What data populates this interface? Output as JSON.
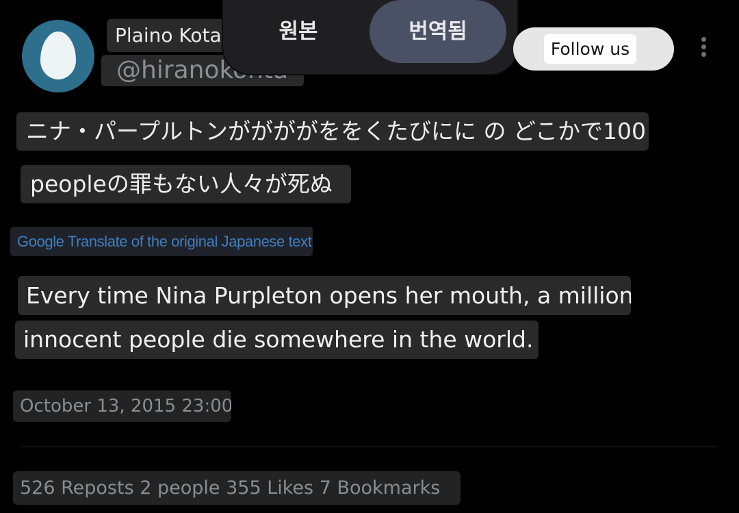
{
  "author": {
    "display_name": "Plaino Kota",
    "handle": "@hiranokonta"
  },
  "translation_toggle": {
    "original_label": "원본",
    "translated_label": "번역됨",
    "selected": "translated"
  },
  "follow_button": {
    "label": "Follow us"
  },
  "japanese_text": {
    "line1": "ニナ・パープルトンががががををくたびにに の どこかで100",
    "line2": "peopleの罪もない人々が死ぬ"
  },
  "translation_note": "Google Translate of the original Japanese text",
  "english_text": {
    "line1": "Every time Nina Purpleton opens her mouth, a million",
    "line2": "innocent people die somewhere in the world."
  },
  "timestamp": "October 13, 2015 23:00",
  "stats": "526 Reposts 2 people 355 Likes 7 Bookmarks",
  "colors": {
    "background": "#000000",
    "avatar": "#2f6f8e",
    "toggle_selected": "#4a5164",
    "translate_link": "#3f7fc0"
  },
  "icons": {
    "more_menu": "kebab-vertical-icon"
  }
}
